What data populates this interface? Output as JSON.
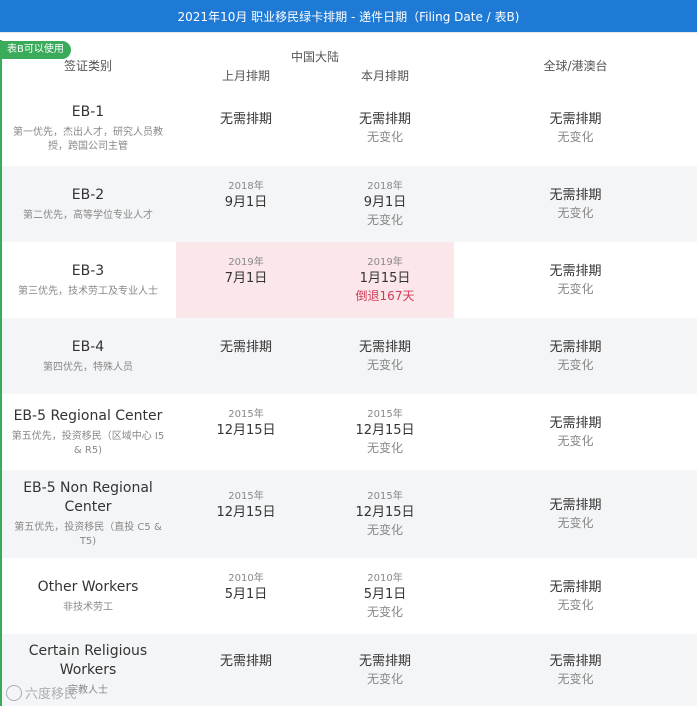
{
  "title": "2021年10月 职业移民绿卡排期 - 递件日期（Filing Date / 表B)",
  "badge": "表B可以使用",
  "header": {
    "category": "签证类别",
    "group": "中国大陆",
    "last_month": "上月排期",
    "this_month": "本月排期",
    "global": "全球/港澳台"
  },
  "rows": [
    {
      "name": "EB-1",
      "desc": "第一优先，杰出人才，研究人员教授，跨国公司主管",
      "last": {
        "year": "",
        "date": "无需排期"
      },
      "cur": {
        "year": "",
        "date": "无需排期",
        "status": "无变化"
      },
      "glob": {
        "date": "无需排期",
        "status": "无变化"
      }
    },
    {
      "name": "EB-2",
      "desc": "第二优先，高等学位专业人才",
      "last": {
        "year": "2018年",
        "date": "9月1日"
      },
      "cur": {
        "year": "2018年",
        "date": "9月1日",
        "status": "无变化"
      },
      "glob": {
        "date": "无需排期",
        "status": "无变化"
      }
    },
    {
      "name": "EB-3",
      "desc": "第三优先，技术劳工及专业人士",
      "last": {
        "year": "2019年",
        "date": "7月1日"
      },
      "cur": {
        "year": "2019年",
        "date": "1月15日",
        "status": "倒退167天"
      },
      "glob": {
        "date": "无需排期",
        "status": "无变化"
      }
    },
    {
      "name": "EB-4",
      "desc": "第四优先，特殊人员",
      "last": {
        "year": "",
        "date": "无需排期"
      },
      "cur": {
        "year": "",
        "date": "无需排期",
        "status": "无变化"
      },
      "glob": {
        "date": "无需排期",
        "status": "无变化"
      }
    },
    {
      "name": "EB-5 Regional Center",
      "desc": "第五优先，投资移民（区域中心 I5 & R5)",
      "last": {
        "year": "2015年",
        "date": "12月15日"
      },
      "cur": {
        "year": "2015年",
        "date": "12月15日",
        "status": "无变化"
      },
      "glob": {
        "date": "无需排期",
        "status": "无变化"
      }
    },
    {
      "name": "EB-5 Non Regional Center",
      "desc": "第五优先，投资移民（直投 C5 & T5)",
      "last": {
        "year": "2015年",
        "date": "12月15日"
      },
      "cur": {
        "year": "2015年",
        "date": "12月15日",
        "status": "无变化"
      },
      "glob": {
        "date": "无需排期",
        "status": "无变化"
      }
    },
    {
      "name": "Other Workers",
      "desc": "非技术劳工",
      "last": {
        "year": "2010年",
        "date": "5月1日"
      },
      "cur": {
        "year": "2010年",
        "date": "5月1日",
        "status": "无变化"
      },
      "glob": {
        "date": "无需排期",
        "status": "无变化"
      }
    },
    {
      "name": "Certain Religious Workers",
      "desc": "宗教人士",
      "last": {
        "year": "",
        "date": "无需排期"
      },
      "cur": {
        "year": "",
        "date": "无需排期",
        "status": "无变化"
      },
      "glob": {
        "date": "无需排期",
        "status": "无变化"
      }
    }
  ],
  "watermark": "六度移民",
  "colors": {
    "title_bg": "#1f7ad6",
    "badge": "#3aab5b",
    "highlight": "#fbe6ea",
    "retrogress": "#d23a57"
  }
}
